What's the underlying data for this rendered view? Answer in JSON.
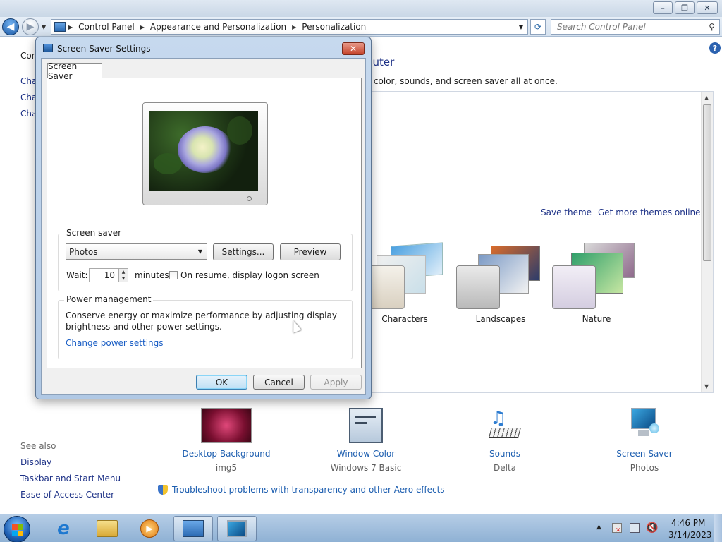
{
  "window": {
    "controls": {
      "minimize": "–",
      "maximize": "❐",
      "close": "✕"
    }
  },
  "address": {
    "crumbs": [
      "Control Panel",
      "Appearance and Personalization",
      "Personalization"
    ],
    "search_placeholder": "Search Control Panel"
  },
  "left_pane": {
    "truncated_items": [
      "Con",
      "Cha",
      "Cha",
      "Cha"
    ],
    "see_also_label": "See also",
    "see_also": [
      "Display",
      "Taskbar and Start Menu",
      "Ease of Access Center"
    ]
  },
  "content": {
    "heading_fragment": "puter",
    "desc_fragment": "v color, sounds, and screen saver all at once.",
    "save_theme": "Save theme",
    "get_more_themes": "Get more themes online",
    "themes": [
      "Characters",
      "Landscapes",
      "Nature"
    ],
    "personalize_items": [
      {
        "title": "Desktop Background",
        "sub": "img5"
      },
      {
        "title": "Window Color",
        "sub": "Windows 7 Basic"
      },
      {
        "title": "Sounds",
        "sub": "Delta"
      },
      {
        "title": "Screen Saver",
        "sub": "Photos"
      }
    ],
    "troubleshoot": "Troubleshoot problems with transparency and other Aero effects"
  },
  "dialog": {
    "title": "Screen Saver Settings",
    "tab": "Screen Saver",
    "screensaver_group": "Screen saver",
    "screensaver_value": "Photos",
    "settings_btn": "Settings...",
    "preview_btn": "Preview",
    "wait_label": "Wait:",
    "wait_value": "10",
    "minutes_label": "minutes",
    "resume_label": "On resume, display logon screen",
    "power_group": "Power management",
    "power_text_1": "Conserve energy or maximize performance by adjusting display",
    "power_text_2": "brightness and other power settings.",
    "power_link": "Change power settings",
    "ok": "OK",
    "cancel": "Cancel",
    "apply": "Apply"
  },
  "taskbar": {
    "time": "4:46 PM",
    "date": "3/14/2023"
  },
  "colors": {
    "link_blue": "#1e3287",
    "item_link": "#1e5fb0",
    "taskbar_top": "#b6cde6"
  }
}
